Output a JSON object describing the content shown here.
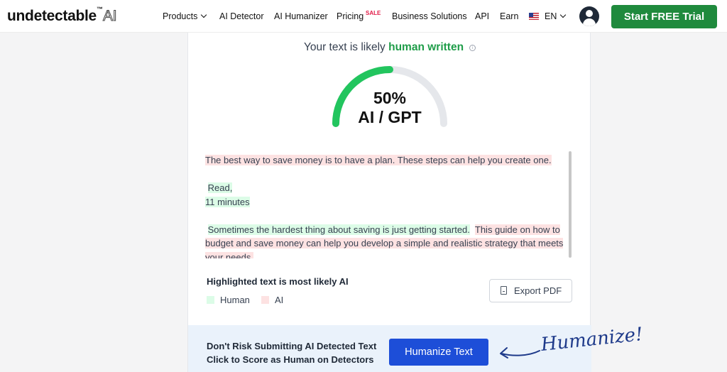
{
  "nav": {
    "logo": "undetectable",
    "logo_tm": "™",
    "logo_ai": "AI",
    "products": "Products",
    "ai_detector": "AI Detector",
    "ai_humanizer": "AI Humanizer",
    "pricing": "Pricing",
    "sale": "SALE",
    "business": "Business Solutions",
    "api": "API",
    "earn": "Earn",
    "language": "EN",
    "cta": "Start FREE Trial"
  },
  "result": {
    "verdict_prefix": "Your text is likely",
    "verdict_highlight": "human written",
    "percent": "50%",
    "percent_value": 50,
    "gauge_label": "AI / GPT"
  },
  "text_blocks": [
    {
      "text": "The best way to save money is to have a plan.  These steps can help you create one.",
      "type": "ai"
    },
    {
      "text": "Read,",
      "type": "human"
    },
    {
      "text": "11 minutes",
      "type": "human"
    },
    {
      "text": "Sometimes the hardest thing about saving is just getting started.",
      "type": "human"
    },
    {
      "text": "This guide on how to budget and save money can help you develop a simple and realistic strategy that meets your needs.",
      "type": "ai"
    }
  ],
  "legend": {
    "note": "Highlighted text is most likely AI",
    "human": "Human",
    "ai": "AI"
  },
  "export_label": "Export PDF",
  "banner": {
    "line1": "Don't Risk Submitting AI Detected Text",
    "line2": "Click to Score as Human on Detectors",
    "button": "Humanize Text",
    "script": "Humanize!"
  },
  "colors": {
    "green": "#1f8a3d",
    "human_highlight": "#dcfce7",
    "ai_highlight": "#fde2e2",
    "blue_button": "#1d4ed8"
  }
}
